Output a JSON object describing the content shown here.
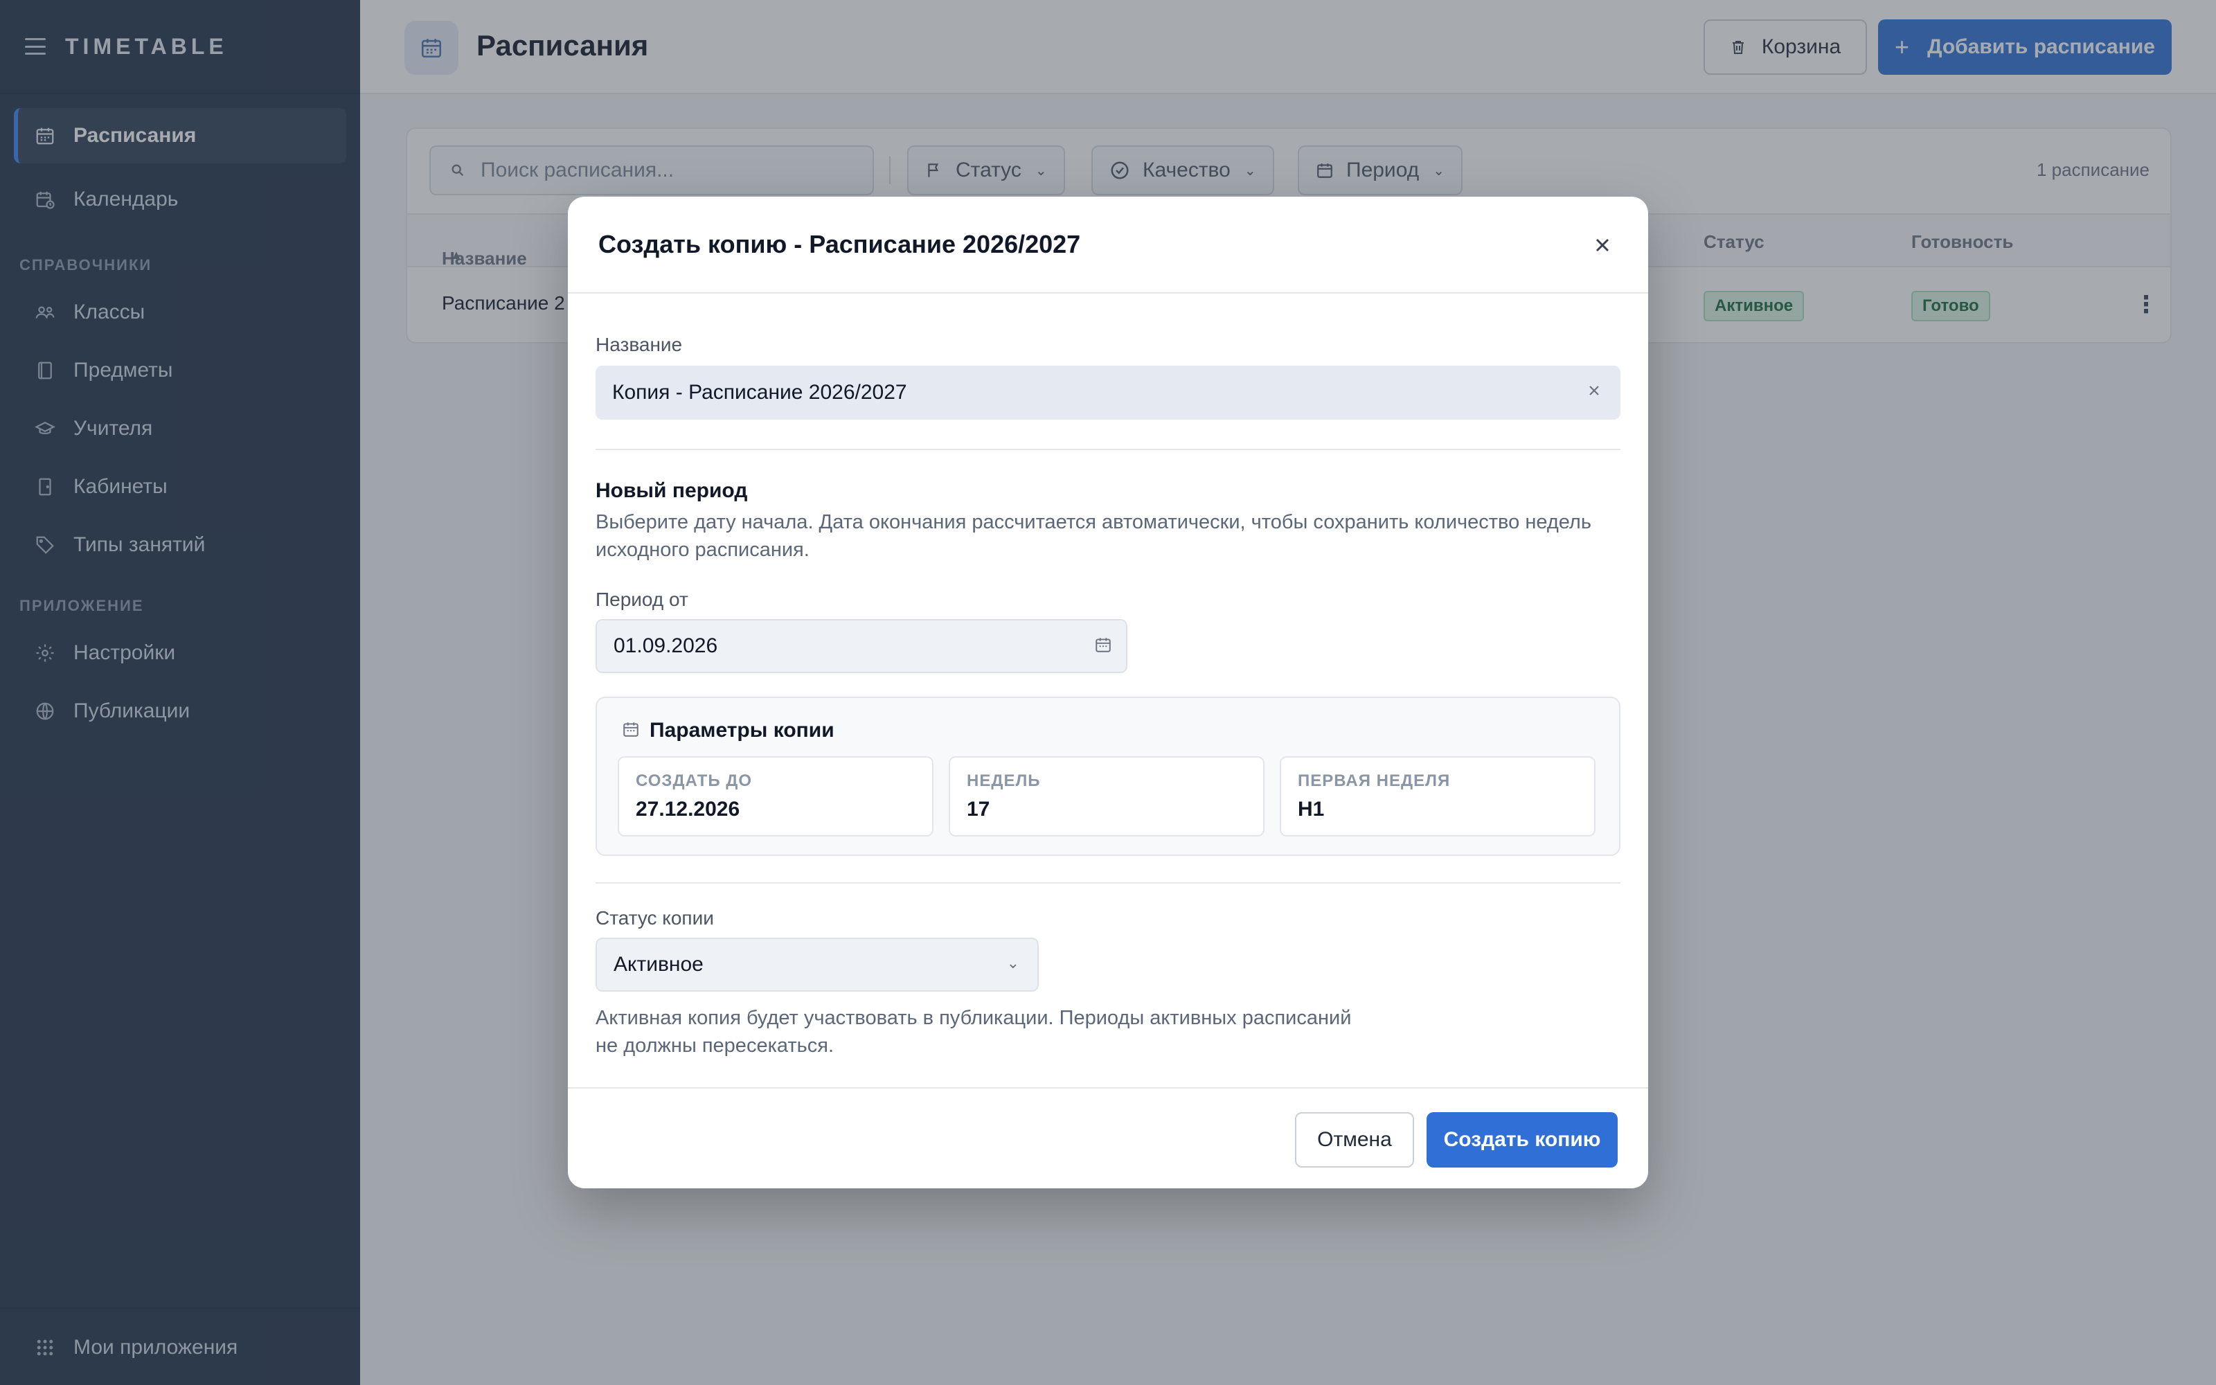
{
  "app": {
    "brand": "TIMETABLE"
  },
  "sidebar": {
    "items": [
      {
        "label": "Расписания",
        "icon": "calendar-icon",
        "active": true
      },
      {
        "label": "Календарь",
        "icon": "calendar-clock-icon"
      }
    ],
    "section_refs": "СПРАВОЧНИКИ",
    "refs": [
      {
        "label": "Классы",
        "icon": "users-icon"
      },
      {
        "label": "Предметы",
        "icon": "book-icon"
      },
      {
        "label": "Учителя",
        "icon": "graduation-cap-icon"
      },
      {
        "label": "Кабинеты",
        "icon": "door-icon"
      },
      {
        "label": "Типы занятий",
        "icon": "tag-icon"
      }
    ],
    "section_app": "ПРИЛОЖЕНИЕ",
    "app_items": [
      {
        "label": "Настройки",
        "icon": "gear-icon"
      },
      {
        "label": "Публикации",
        "icon": "globe-icon"
      }
    ],
    "footer": {
      "label": "Мои приложения",
      "icon": "grid-icon"
    }
  },
  "header": {
    "title": "Расписания",
    "trash_label": "Корзина",
    "add_label": "Добавить расписание"
  },
  "list": {
    "search_placeholder": "Поиск расписания...",
    "filters": [
      "Статус",
      "Качество",
      "Период"
    ],
    "count": "1 расписание",
    "columns": {
      "name": "Название",
      "status": "Статус",
      "ready": "Готовность"
    },
    "rows": [
      {
        "name": "Расписание 2",
        "status": "Активное",
        "ready": "Готово"
      }
    ]
  },
  "modal": {
    "title": "Создать копию - Расписание 2026/2027",
    "name_label": "Название",
    "name_value": "Копия - Расписание 2026/2027",
    "period_title": "Новый период",
    "period_help": "Выберите дату начала. Дата окончания рассчитается автоматически, чтобы сохранить количество недель исходного расписания.",
    "period_from_label": "Период от",
    "period_from_value": "01.09.2026",
    "params_title": "Параметры копии",
    "params": [
      {
        "label": "СОЗДАТЬ ДО",
        "value": "27.12.2026"
      },
      {
        "label": "НЕДЕЛЬ",
        "value": "17"
      },
      {
        "label": "ПЕРВАЯ НЕДЕЛЯ",
        "value": "H1"
      }
    ],
    "status_label": "Статус копии",
    "status_value": "Активное",
    "status_help_1": "Активная копия будет участвовать в публикации. Периоды активных расписаний",
    "status_help_2": "не должны пересекаться.",
    "cancel_label": "Отмена",
    "create_label": "Создать копию"
  },
  "colors": {
    "accent": "#2f6fd6",
    "sidebar": "#223247",
    "success": "#16683a"
  }
}
